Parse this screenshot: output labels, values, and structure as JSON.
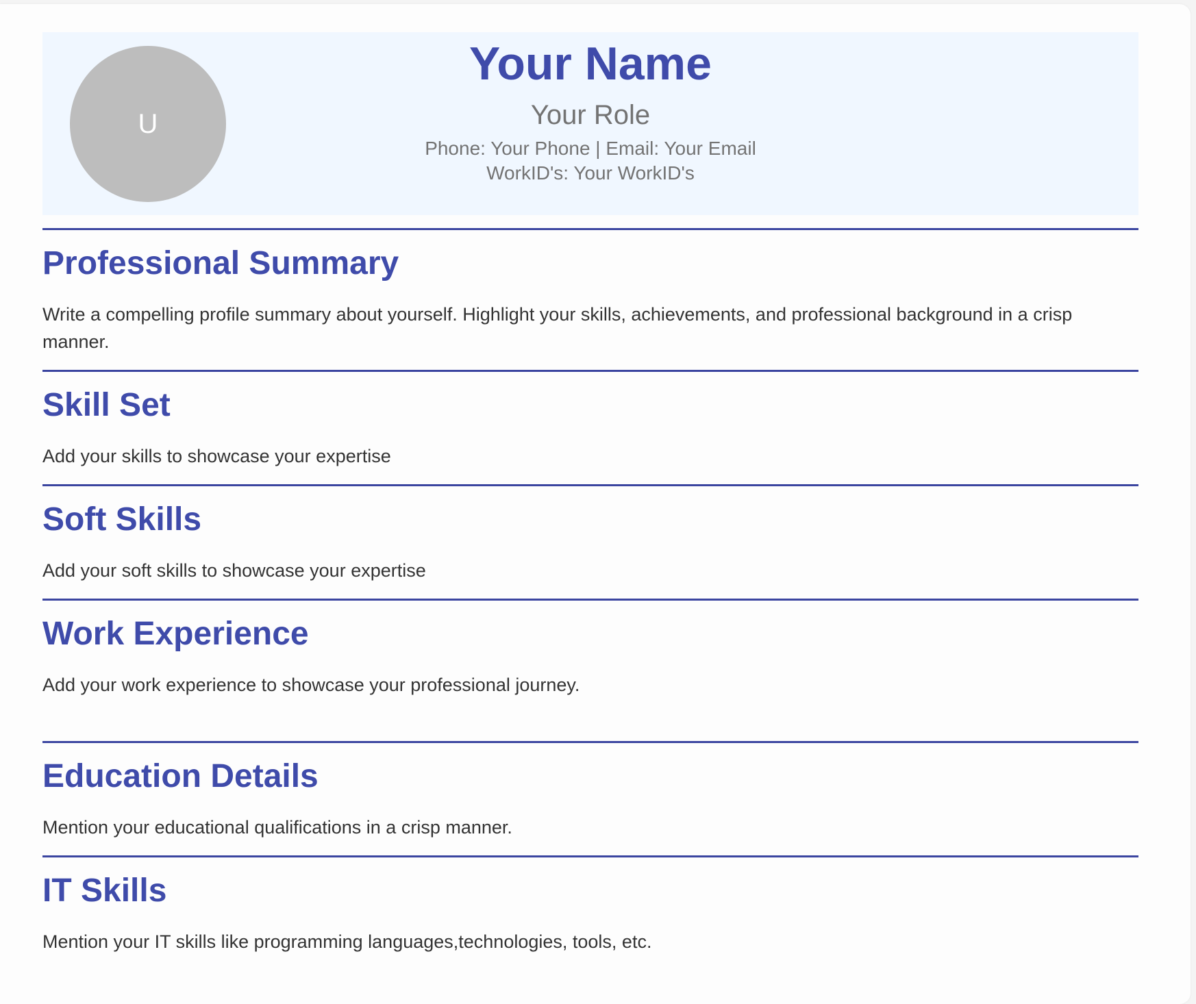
{
  "header": {
    "avatar_initial": "U",
    "name": "Your Name",
    "role": "Your Role",
    "contact": "Phone: Your Phone | Email: Your Email",
    "work_ids": "WorkID's: Your WorkID's"
  },
  "colors": {
    "accent": "#3f4baa",
    "header_bg": "#f0f7ff",
    "avatar_bg": "#bdbdbd",
    "text": "#333333"
  },
  "sections": [
    {
      "title": "Professional Summary",
      "body": "Write a compelling profile summary about yourself. Highlight your skills, achievements, and professional background in a crisp manner."
    },
    {
      "title": "Skill Set",
      "body": "Add your skills to showcase your expertise"
    },
    {
      "title": "Soft Skills",
      "body": "Add your soft skills to showcase your expertise"
    },
    {
      "title": "Work Experience",
      "body": "Add your work experience to showcase your professional journey."
    },
    {
      "title": "Education Details",
      "body": "Mention your educational qualifications in a crisp manner."
    },
    {
      "title": "IT Skills",
      "body": "Mention your IT skills like programming languages,technologies, tools, etc."
    }
  ]
}
